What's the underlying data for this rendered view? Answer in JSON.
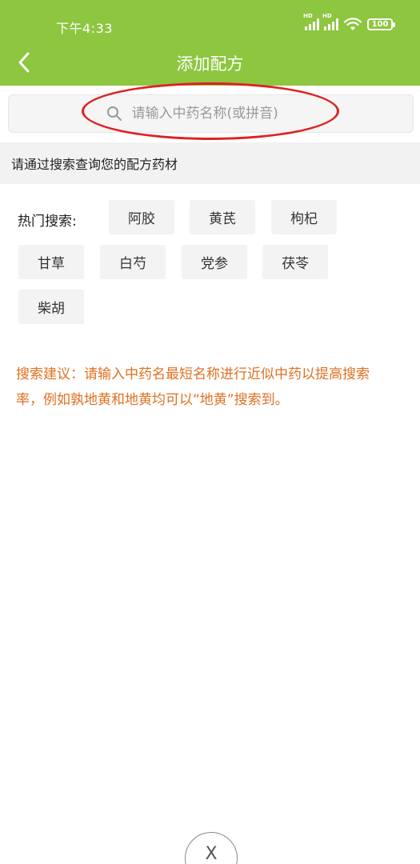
{
  "status_bar": {
    "time": "下午4:33",
    "battery": "100",
    "hd1": "HD",
    "hd2": "HD"
  },
  "header": {
    "title": "添加配方"
  },
  "search": {
    "placeholder": "请输入中药名称(或拼音)"
  },
  "section": {
    "prompt": "请通过搜索查询您的配方药材"
  },
  "hot": {
    "label": "热门搜索:",
    "tags": [
      "阿胶",
      "黄芪",
      "枸杞",
      "甘草",
      "白芍",
      "党参",
      "茯苓",
      "柴胡"
    ]
  },
  "tip": {
    "text": "搜索建议：请输入中药名最短名称进行近似中药以提高搜索率，例如孰地黄和地黄均可以“地黄”搜索到。"
  },
  "close": {
    "label": "X"
  },
  "colors": {
    "header_green": "#8dc63f",
    "tip_orange": "#e07020",
    "highlight_red": "#e02020"
  }
}
